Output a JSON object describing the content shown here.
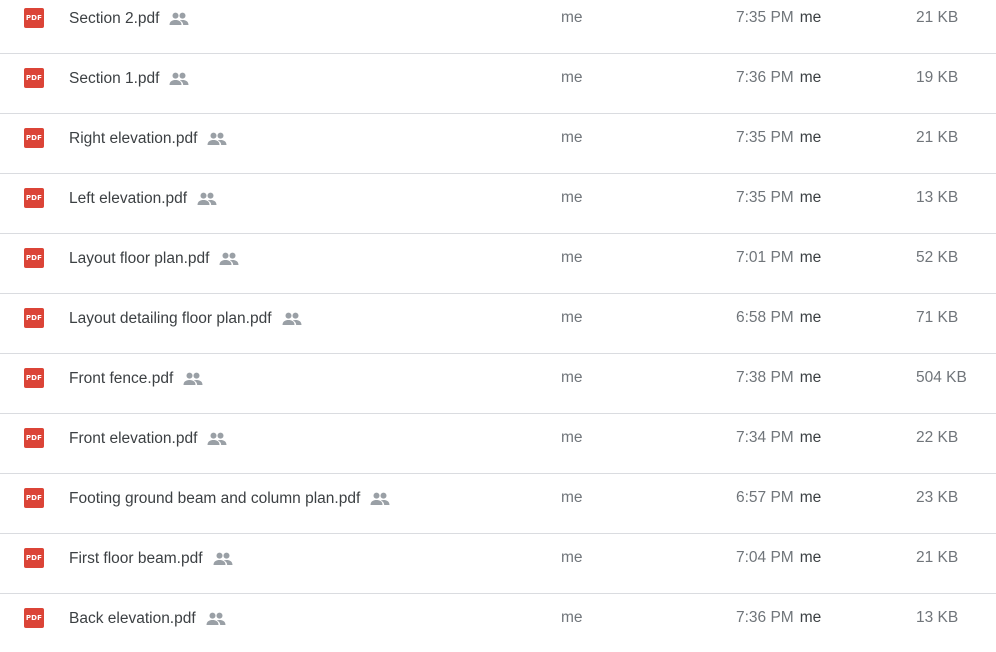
{
  "files": [
    {
      "name": "Section 2.pdf",
      "owner": "me",
      "modified_time": "7:35 PM",
      "modified_by": "me",
      "size": "21 KB"
    },
    {
      "name": "Section 1.pdf",
      "owner": "me",
      "modified_time": "7:36 PM",
      "modified_by": "me",
      "size": "19 KB"
    },
    {
      "name": "Right elevation.pdf",
      "owner": "me",
      "modified_time": "7:35 PM",
      "modified_by": "me",
      "size": "21 KB"
    },
    {
      "name": "Left elevation.pdf",
      "owner": "me",
      "modified_time": "7:35 PM",
      "modified_by": "me",
      "size": "13 KB"
    },
    {
      "name": "Layout floor plan.pdf",
      "owner": "me",
      "modified_time": "7:01 PM",
      "modified_by": "me",
      "size": "52 KB"
    },
    {
      "name": "Layout detailing floor plan.pdf",
      "owner": "me",
      "modified_time": "6:58 PM",
      "modified_by": "me",
      "size": "71 KB"
    },
    {
      "name": "Front fence.pdf",
      "owner": "me",
      "modified_time": "7:38 PM",
      "modified_by": "me",
      "size": "504 KB"
    },
    {
      "name": "Front elevation.pdf",
      "owner": "me",
      "modified_time": "7:34 PM",
      "modified_by": "me",
      "size": "22 KB"
    },
    {
      "name": "Footing ground beam and column plan.pdf",
      "owner": "me",
      "modified_time": "6:57 PM",
      "modified_by": "me",
      "size": "23 KB"
    },
    {
      "name": "First floor beam.pdf",
      "owner": "me",
      "modified_time": "7:04 PM",
      "modified_by": "me",
      "size": "21 KB"
    },
    {
      "name": "Back elevation.pdf",
      "owner": "me",
      "modified_time": "7:36 PM",
      "modified_by": "me",
      "size": "13 KB"
    }
  ],
  "file_icon": {
    "name": "pdf-icon",
    "label": "PDF",
    "color": "#db4437"
  },
  "shared_icon": {
    "name": "shared-people-icon",
    "color": "#9aa0a6"
  }
}
